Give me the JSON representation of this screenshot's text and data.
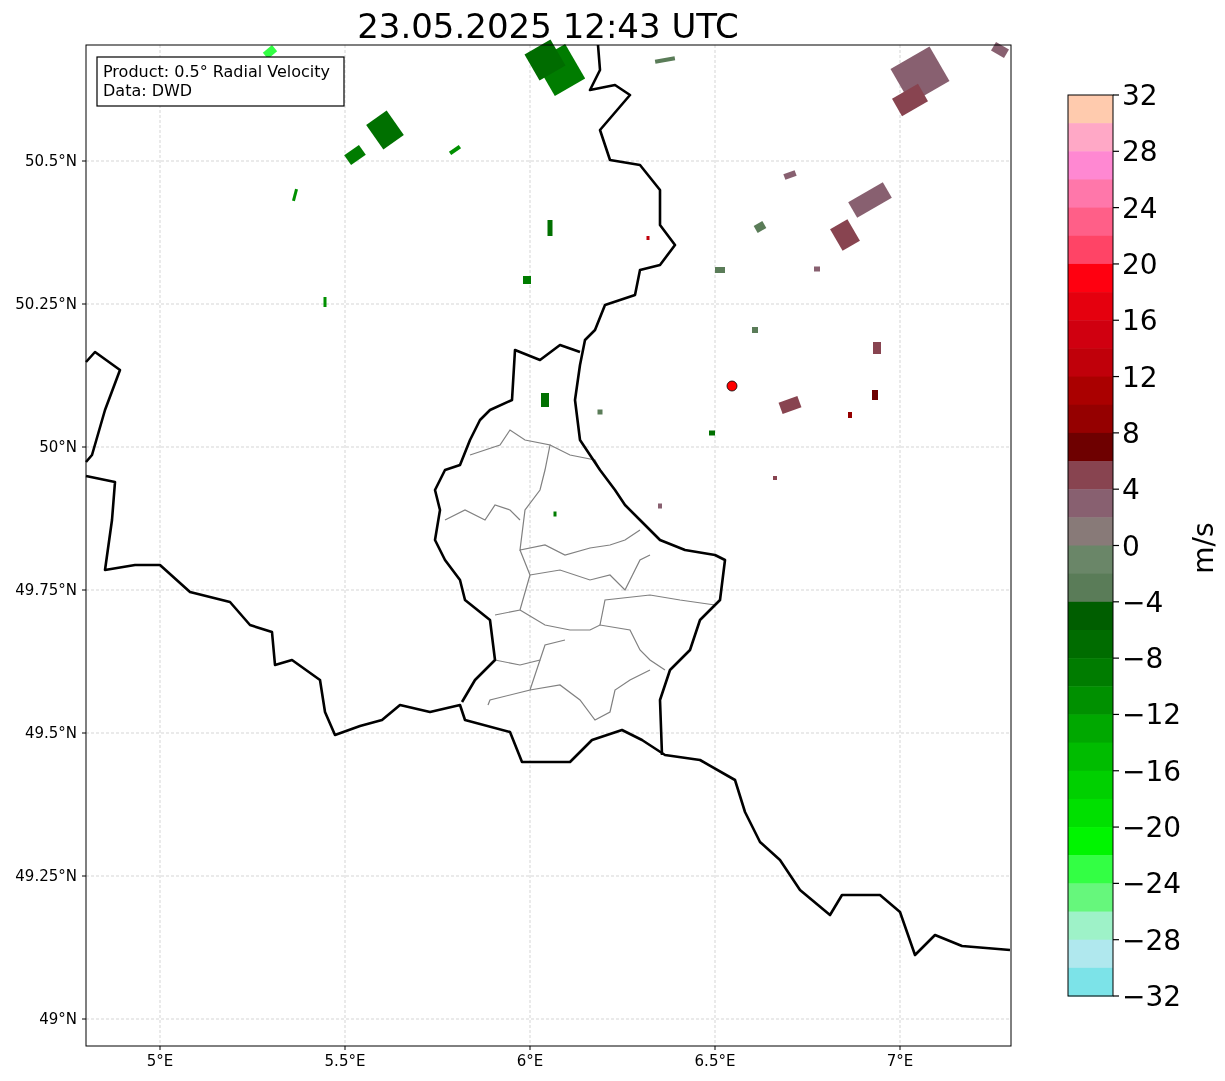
{
  "title": "23.05.2025 12:43 UTC",
  "info_box": [
    "Product: 0.5° Radial Velocity",
    "Data: DWD"
  ],
  "map": {
    "lon_ticks": [
      "5°E",
      "5.5°E",
      "6°E",
      "6.5°E",
      "7°E"
    ],
    "lat_ticks": [
      "50.5°N",
      "50.25°N",
      "50°N",
      "49.75°N",
      "49.5°N",
      "49.25°N",
      "49°N"
    ]
  },
  "colorbar": {
    "label": "m/s",
    "bins": [
      {
        "color": "#ffcbae"
      },
      {
        "color": "#ffa8c6"
      },
      {
        "color": "#ff88d2"
      },
      {
        "color": "#ff77aa"
      },
      {
        "color": "#ff5f88"
      },
      {
        "color": "#ff4466"
      },
      {
        "color": "#ff0010"
      },
      {
        "color": "#e5000e"
      },
      {
        "color": "#d00010"
      },
      {
        "color": "#c0000a"
      },
      {
        "color": "#aa0000"
      },
      {
        "color": "#950000"
      },
      {
        "color": "#6e0000"
      },
      {
        "color": "#884450"
      },
      {
        "color": "#886070"
      },
      {
        "color": "#887a78"
      },
      {
        "color": "#6a8668"
      },
      {
        "color": "#5a7c58"
      },
      {
        "color": "#005e00"
      },
      {
        "color": "#006c00"
      },
      {
        "color": "#007c00"
      },
      {
        "color": "#009000"
      },
      {
        "color": "#00a800"
      },
      {
        "color": "#00bc00"
      },
      {
        "color": "#00d000"
      },
      {
        "color": "#00e000"
      },
      {
        "color": "#00f500"
      },
      {
        "color": "#33ff44"
      },
      {
        "color": "#66f77c"
      },
      {
        "color": "#9ef2c8"
      },
      {
        "color": "#b0e8ee"
      },
      {
        "color": "#7ce3e8"
      }
    ],
    "ticks": [
      "32",
      "28",
      "24",
      "20",
      "16",
      "12",
      "8",
      "4",
      "0",
      "−4",
      "−8",
      "−12",
      "−16",
      "−20",
      "−24",
      "−28",
      "−32"
    ]
  }
}
